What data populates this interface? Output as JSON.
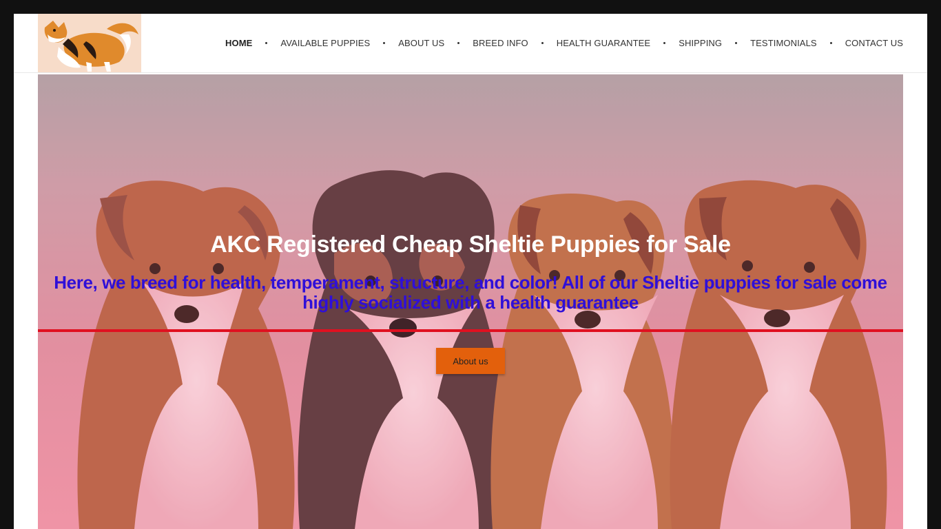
{
  "site": {
    "logo_icon": "sheltie-dog-logo-icon"
  },
  "nav": {
    "items": [
      {
        "label": "HOME",
        "active": true
      },
      {
        "label": "AVAILABLE PUPPIES",
        "active": false
      },
      {
        "label": "ABOUT US",
        "active": false
      },
      {
        "label": "BREED INFO",
        "active": false
      },
      {
        "label": "HEALTH GUARANTEE",
        "active": false
      },
      {
        "label": "SHIPPING",
        "active": false
      },
      {
        "label": "TESTIMONIALS",
        "active": false
      },
      {
        "label": "CONTACT US",
        "active": false
      }
    ]
  },
  "hero": {
    "title": "AKC Registered Cheap Sheltie Puppies for Sale",
    "subtitle": "Here, we breed for health, temperament, structure, and color! All of our Sheltie puppies for sale come highly socialized with a health guarantee",
    "button_label": "About us",
    "image": "four-sheltie-puppies-photo"
  },
  "colors": {
    "accent_orange": "#e3600c",
    "subtitle_blue": "#2f0fd8",
    "divider_red": "#e01020",
    "page_border": "#111111"
  }
}
